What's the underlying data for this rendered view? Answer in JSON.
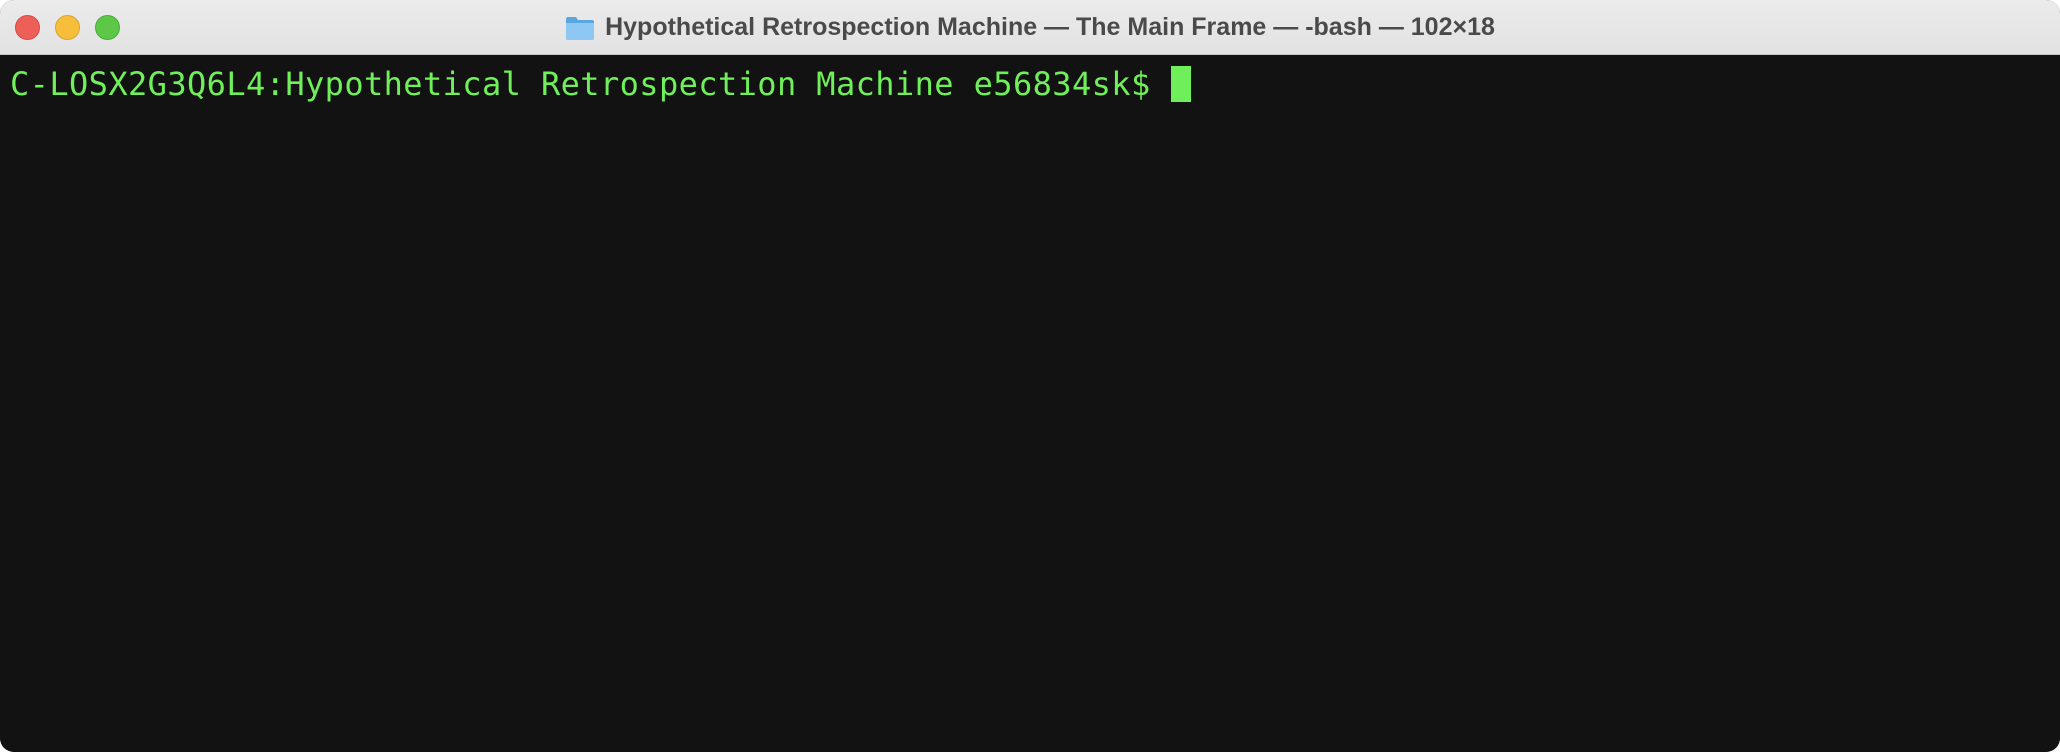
{
  "window": {
    "title": "Hypothetical Retrospection Machine — The Main Frame — -bash — 102×18",
    "title_icon": "folder-icon",
    "controls": {
      "close": "close-button",
      "minimize": "minimize-button",
      "zoom": "zoom-button"
    }
  },
  "terminal": {
    "prompt": "C-LOSX2G3Q6L4:Hypothetical Retrospection Machine e56834sk$",
    "text_color": "#6ff05a",
    "background": "#121212"
  }
}
